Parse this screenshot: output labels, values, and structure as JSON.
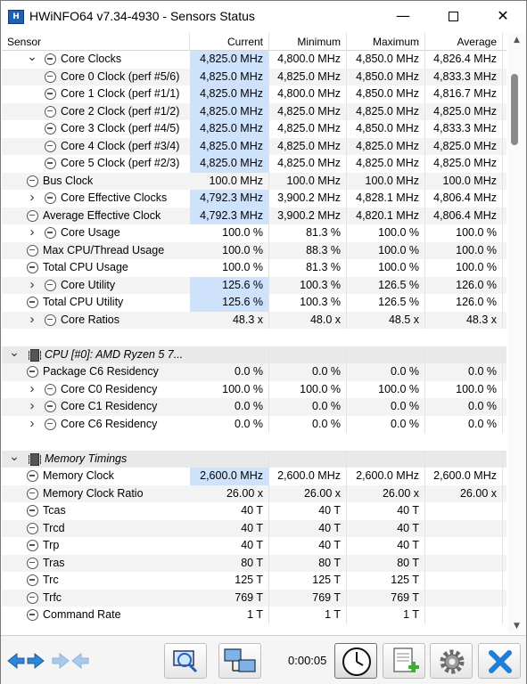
{
  "window": {
    "title": "HWiNFO64 v7.34-4930 - Sensors Status",
    "app_icon_text": "H"
  },
  "columns": {
    "sensor": "Sensor",
    "current": "Current",
    "minimum": "Minimum",
    "maximum": "Maximum",
    "average": "Average"
  },
  "rows": [
    {
      "label": "Core Clocks",
      "level": 1,
      "expander": "expanded",
      "icon": "clock",
      "cur": "4,825.0 MHz",
      "min": "4,800.0 MHz",
      "max": "4,850.0 MHz",
      "avg": "4,826.4 MHz",
      "hl": true
    },
    {
      "label": "Core 0 Clock (perf #5/6)",
      "level": 2,
      "expander": "",
      "icon": "clock",
      "cur": "4,825.0 MHz",
      "min": "4,825.0 MHz",
      "max": "4,850.0 MHz",
      "avg": "4,833.3 MHz",
      "hl": true
    },
    {
      "label": "Core 1 Clock (perf #1/1)",
      "level": 2,
      "expander": "",
      "icon": "clock",
      "cur": "4,825.0 MHz",
      "min": "4,800.0 MHz",
      "max": "4,850.0 MHz",
      "avg": "4,816.7 MHz",
      "hl": true
    },
    {
      "label": "Core 2 Clock (perf #1/2)",
      "level": 2,
      "expander": "",
      "icon": "clock",
      "cur": "4,825.0 MHz",
      "min": "4,825.0 MHz",
      "max": "4,825.0 MHz",
      "avg": "4,825.0 MHz",
      "hl": true
    },
    {
      "label": "Core 3 Clock (perf #4/5)",
      "level": 2,
      "expander": "",
      "icon": "clock",
      "cur": "4,825.0 MHz",
      "min": "4,825.0 MHz",
      "max": "4,850.0 MHz",
      "avg": "4,833.3 MHz",
      "hl": true
    },
    {
      "label": "Core 4 Clock (perf #3/4)",
      "level": 2,
      "expander": "",
      "icon": "clock",
      "cur": "4,825.0 MHz",
      "min": "4,825.0 MHz",
      "max": "4,825.0 MHz",
      "avg": "4,825.0 MHz",
      "hl": true
    },
    {
      "label": "Core 5 Clock (perf #2/3)",
      "level": 2,
      "expander": "",
      "icon": "clock",
      "cur": "4,825.0 MHz",
      "min": "4,825.0 MHz",
      "max": "4,825.0 MHz",
      "avg": "4,825.0 MHz",
      "hl": true
    },
    {
      "label": "Bus Clock",
      "level": 0,
      "expander": "",
      "icon": "clock",
      "cur": "100.0 MHz",
      "min": "100.0 MHz",
      "max": "100.0 MHz",
      "avg": "100.0 MHz",
      "hl": false
    },
    {
      "label": "Core Effective Clocks",
      "level": 1,
      "expander": "collapsed",
      "icon": "clock",
      "cur": "4,792.3 MHz",
      "min": "3,900.2 MHz",
      "max": "4,828.1 MHz",
      "avg": "4,806.4 MHz",
      "hl": true
    },
    {
      "label": "Average Effective Clock",
      "level": 0,
      "expander": "",
      "icon": "clock",
      "cur": "4,792.3 MHz",
      "min": "3,900.2 MHz",
      "max": "4,820.1 MHz",
      "avg": "4,806.4 MHz",
      "hl": true
    },
    {
      "label": "Core Usage",
      "level": 1,
      "expander": "collapsed",
      "icon": "clock",
      "cur": "100.0 %",
      "min": "81.3 %",
      "max": "100.0 %",
      "avg": "100.0 %",
      "hl": false
    },
    {
      "label": "Max CPU/Thread Usage",
      "level": 0,
      "expander": "",
      "icon": "clock",
      "cur": "100.0 %",
      "min": "88.3 %",
      "max": "100.0 %",
      "avg": "100.0 %",
      "hl": false
    },
    {
      "label": "Total CPU Usage",
      "level": 0,
      "expander": "",
      "icon": "clock",
      "cur": "100.0 %",
      "min": "81.3 %",
      "max": "100.0 %",
      "avg": "100.0 %",
      "hl": false
    },
    {
      "label": "Core Utility",
      "level": 1,
      "expander": "collapsed",
      "icon": "clock",
      "cur": "125.6 %",
      "min": "100.3 %",
      "max": "126.5 %",
      "avg": "126.0 %",
      "hl": true
    },
    {
      "label": "Total CPU Utility",
      "level": 0,
      "expander": "",
      "icon": "clock",
      "cur": "125.6 %",
      "min": "100.3 %",
      "max": "126.5 %",
      "avg": "126.0 %",
      "hl": true
    },
    {
      "label": "Core Ratios",
      "level": 1,
      "expander": "collapsed",
      "icon": "clock",
      "cur": "48.3 x",
      "min": "48.0 x",
      "max": "48.5 x",
      "avg": "48.3 x",
      "hl": false
    },
    {
      "type": "blank"
    },
    {
      "type": "group",
      "label": "CPU [#0]: AMD Ryzen 5 7...",
      "expander": "expanded",
      "icon": "chip"
    },
    {
      "label": "Package C6 Residency",
      "level": 0,
      "expander": "",
      "icon": "clock",
      "cur": "0.0 %",
      "min": "0.0 %",
      "max": "0.0 %",
      "avg": "0.0 %",
      "hl": false
    },
    {
      "label": "Core C0 Residency",
      "level": 1,
      "expander": "collapsed",
      "icon": "clock",
      "cur": "100.0 %",
      "min": "100.0 %",
      "max": "100.0 %",
      "avg": "100.0 %",
      "hl": false
    },
    {
      "label": "Core C1 Residency",
      "level": 1,
      "expander": "collapsed",
      "icon": "clock",
      "cur": "0.0 %",
      "min": "0.0 %",
      "max": "0.0 %",
      "avg": "0.0 %",
      "hl": false
    },
    {
      "label": "Core C6 Residency",
      "level": 1,
      "expander": "collapsed",
      "icon": "clock",
      "cur": "0.0 %",
      "min": "0.0 %",
      "max": "0.0 %",
      "avg": "0.0 %",
      "hl": false
    },
    {
      "type": "blank"
    },
    {
      "type": "group",
      "label": "Memory Timings",
      "expander": "expanded",
      "icon": "chip"
    },
    {
      "label": "Memory Clock",
      "level": 0,
      "expander": "",
      "icon": "clock",
      "cur": "2,600.0 MHz",
      "min": "2,600.0 MHz",
      "max": "2,600.0 MHz",
      "avg": "2,600.0 MHz",
      "hl": true
    },
    {
      "label": "Memory Clock Ratio",
      "level": 0,
      "expander": "",
      "icon": "clock",
      "cur": "26.00 x",
      "min": "26.00 x",
      "max": "26.00 x",
      "avg": "26.00 x",
      "hl": false
    },
    {
      "label": "Tcas",
      "level": 0,
      "expander": "",
      "icon": "clock",
      "cur": "40 T",
      "min": "40 T",
      "max": "40 T",
      "avg": "",
      "hl": false
    },
    {
      "label": "Trcd",
      "level": 0,
      "expander": "",
      "icon": "clock",
      "cur": "40 T",
      "min": "40 T",
      "max": "40 T",
      "avg": "",
      "hl": false
    },
    {
      "label": "Trp",
      "level": 0,
      "expander": "",
      "icon": "clock",
      "cur": "40 T",
      "min": "40 T",
      "max": "40 T",
      "avg": "",
      "hl": false
    },
    {
      "label": "Tras",
      "level": 0,
      "expander": "",
      "icon": "clock",
      "cur": "80 T",
      "min": "80 T",
      "max": "80 T",
      "avg": "",
      "hl": false
    },
    {
      "label": "Trc",
      "level": 0,
      "expander": "",
      "icon": "clock",
      "cur": "125 T",
      "min": "125 T",
      "max": "125 T",
      "avg": "",
      "hl": false
    },
    {
      "label": "Trfc",
      "level": 0,
      "expander": "",
      "icon": "clock",
      "cur": "769 T",
      "min": "769 T",
      "max": "769 T",
      "avg": "",
      "hl": false
    },
    {
      "label": "Command Rate",
      "level": 0,
      "expander": "",
      "icon": "clock",
      "cur": "1 T",
      "min": "1 T",
      "max": "1 T",
      "avg": "",
      "hl": false
    }
  ],
  "toolbar": {
    "timer": "0:00:05"
  },
  "colors": {
    "highlight": "#cfe2fb",
    "stripe": "#f3f3f3",
    "group": "#e9e9e9"
  }
}
